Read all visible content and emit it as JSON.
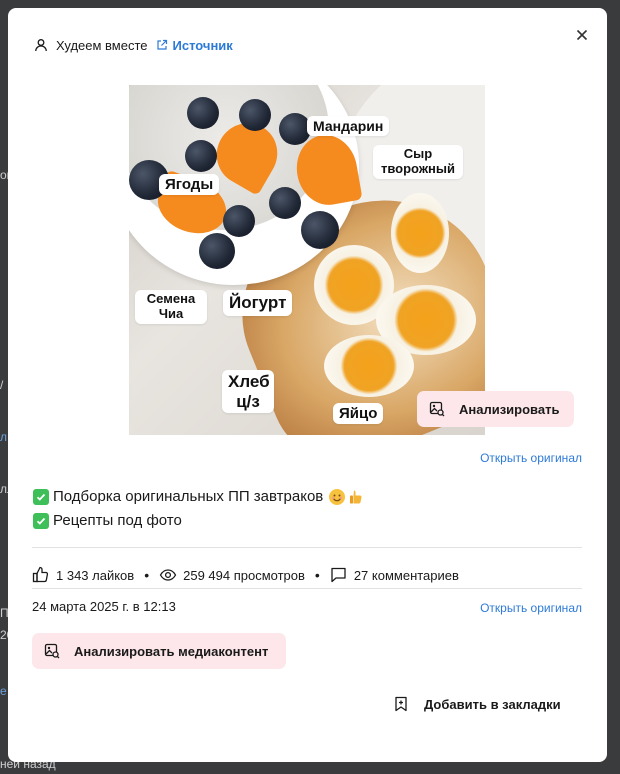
{
  "background": {
    "fragments": [
      "он",
      "/",
      "л",
      "лл",
      "П",
      "20",
      "е",
      "ней назад"
    ]
  },
  "post": {
    "author": "Худеем вместе",
    "source_label": "Источник",
    "image_labels": {
      "mandarin": "Мандарин",
      "cheese": "Сыр творожный",
      "berries": "Ягоды",
      "chia": "Семена Чиа",
      "yogurt": "Йогурт",
      "bread": "Хлеб ц/з",
      "egg": "Яйцо"
    },
    "analyze_image_label": "Анализировать",
    "open_original_label_1": "Открыть оригинал",
    "description": [
      "Подборка оригинальных ПП завтраков",
      "Рецепты под фото"
    ],
    "stats": {
      "likes": "1 343 лайков",
      "views": "259 494 просмотров",
      "comments": "27 комментариев"
    },
    "date": "24 марта 2025 г. в 12:13",
    "open_original_label_2": "Открыть оригинал",
    "analyze_media_label": "Анализировать медиаконтент",
    "bookmark_label": "Добавить в закладки"
  },
  "colors": {
    "accent_link": "#2d7ad6",
    "analyze_bg": "#fde7ea",
    "check_green": "#3fbf5a",
    "backdrop": "#3a3b3d"
  },
  "icons": [
    "user-icon",
    "external-link-icon",
    "close-icon",
    "image-analyze-icon",
    "like-icon",
    "eye-icon",
    "comment-icon",
    "bookmark-add-icon",
    "check-icon",
    "smile-emoji-icon",
    "thumbs-up-emoji-icon"
  ]
}
